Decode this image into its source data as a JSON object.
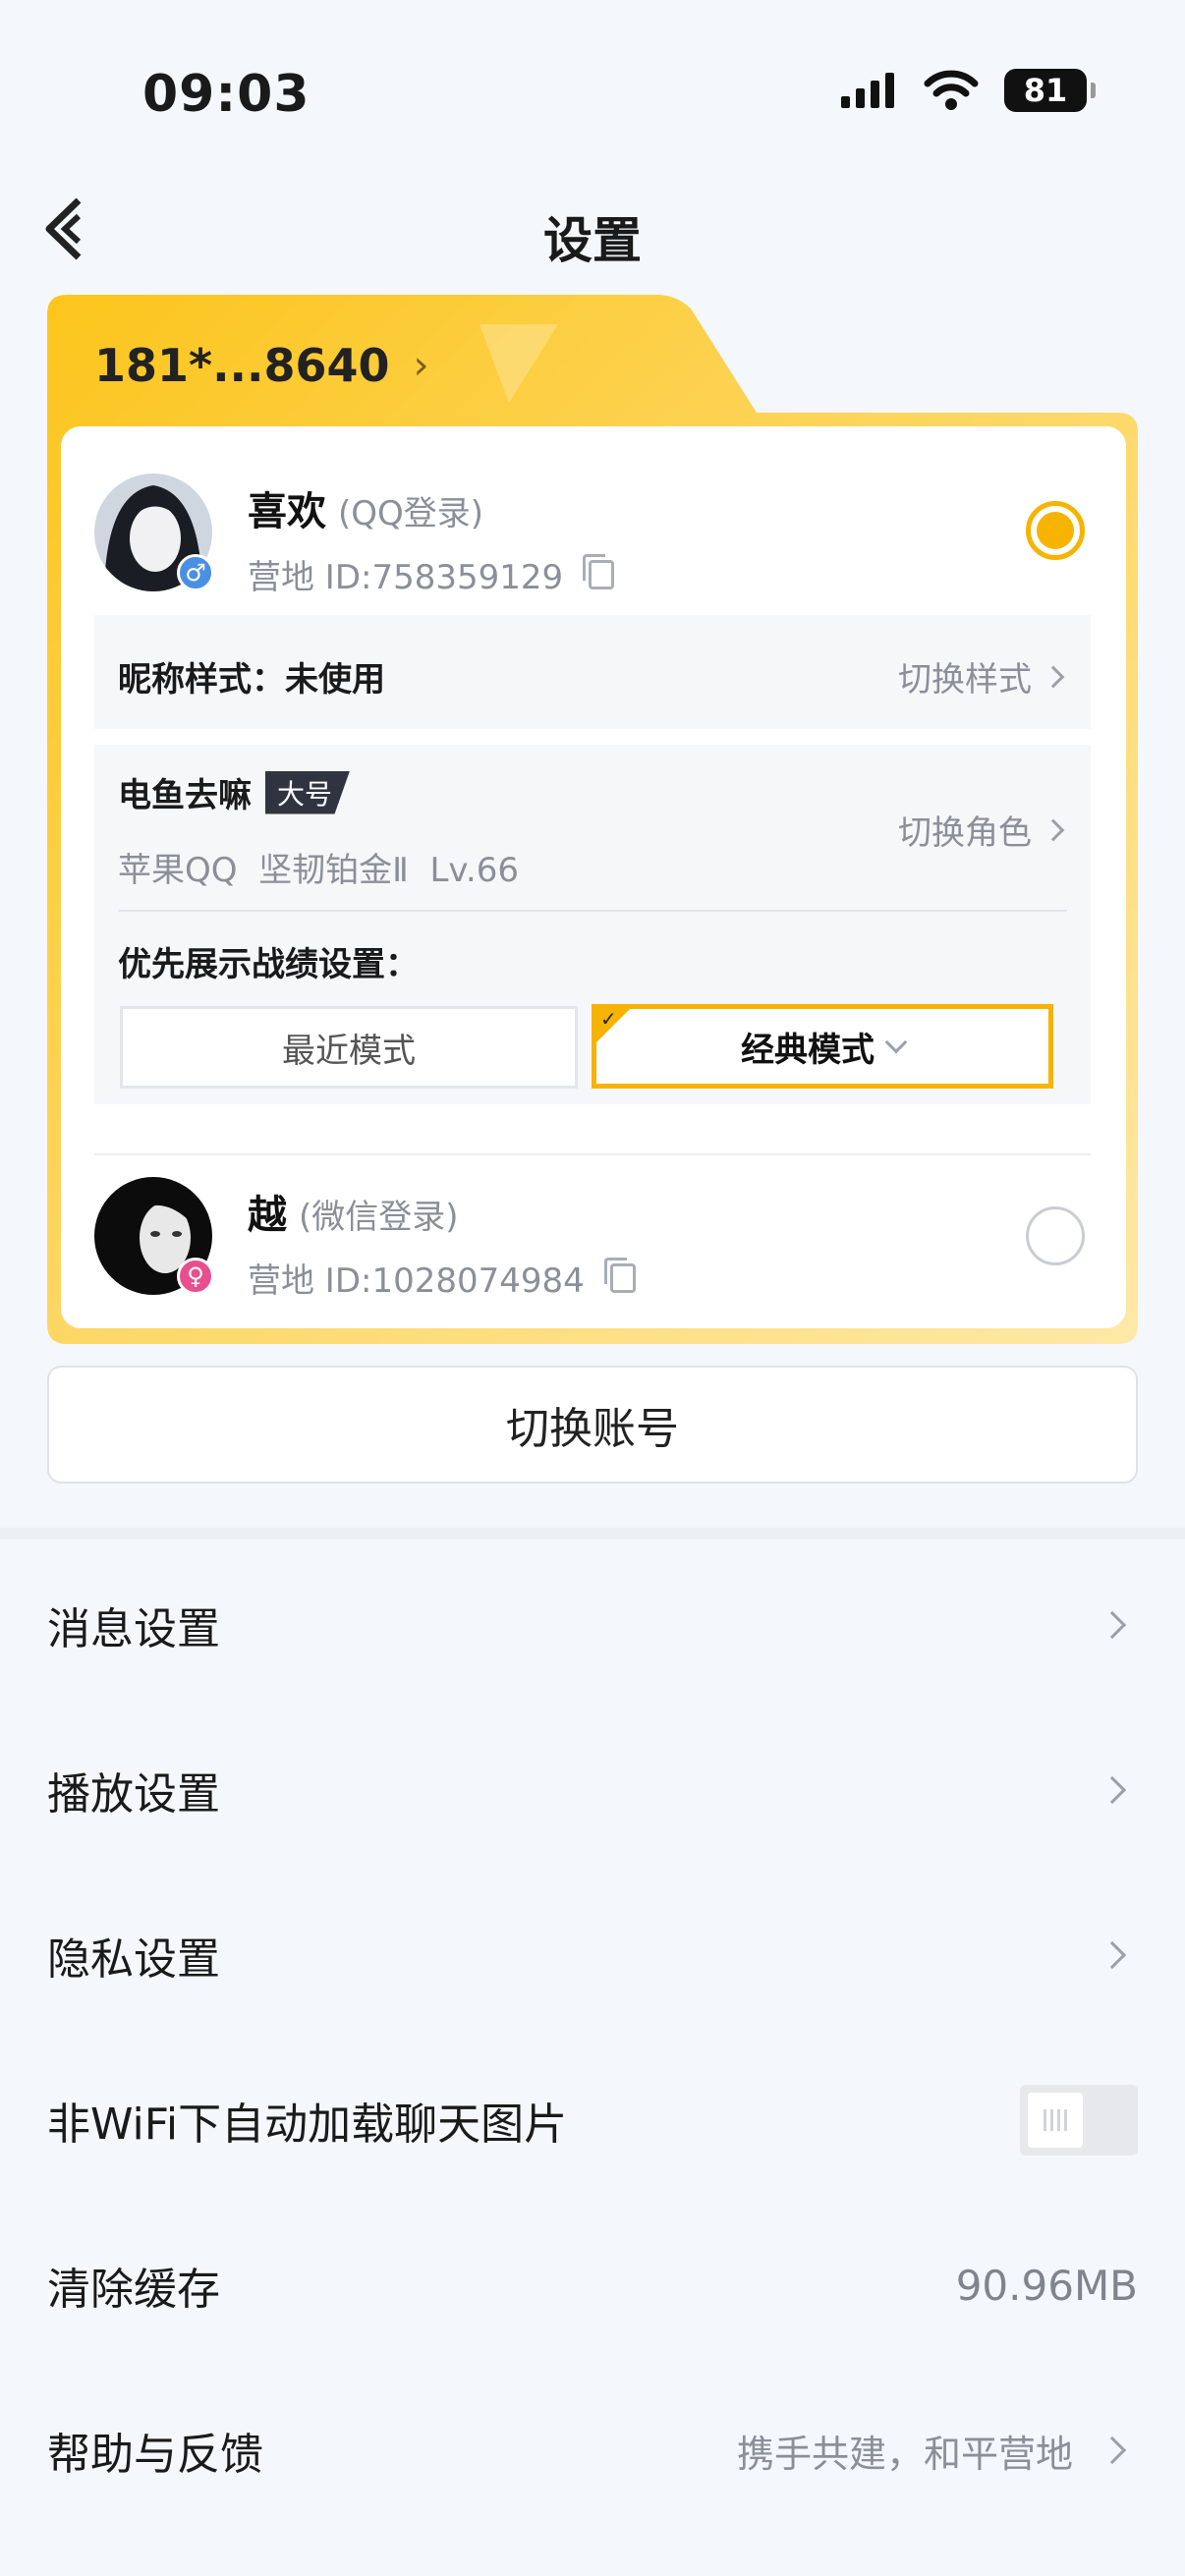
{
  "status_bar": {
    "time": "09:03",
    "battery": "81"
  },
  "nav": {
    "title": "设置"
  },
  "account_card": {
    "phone": "181*...8640",
    "accounts": [
      {
        "name": "喜欢",
        "login_type": "(QQ登录)",
        "id": "营地 ID:758359129",
        "gender": "male",
        "selected": true
      },
      {
        "name": "越",
        "login_type": "(微信登录)",
        "id": "营地 ID:1028074984",
        "gender": "female",
        "selected": false
      }
    ],
    "nickname_style": {
      "label": "昵称样式：未使用",
      "action": "切换样式"
    },
    "role": {
      "name": "电鱼去嘛",
      "tag": "大号",
      "detail": "苹果QQ  坚韧铂金Ⅱ  Lv.66",
      "action": "切换角色"
    },
    "record_setting": {
      "label": "优先展示战绩设置：",
      "mode_recent": "最近模式",
      "mode_classic": "经典模式",
      "selected": "classic"
    }
  },
  "switch_account": "切换账号",
  "settings": [
    {
      "label": "消息设置"
    },
    {
      "label": "播放设置"
    },
    {
      "label": "隐私设置"
    },
    {
      "label": "非WiFi下自动加载聊天图片",
      "toggle": false
    },
    {
      "label": "清除缓存",
      "value": "90.96MB"
    },
    {
      "label": "帮助与反馈",
      "hint": "携手共建，和平营地"
    }
  ],
  "colors": {
    "accent": "#f6b300",
    "card_bg_top": "#fde08a",
    "background": "#f4f7fb"
  }
}
